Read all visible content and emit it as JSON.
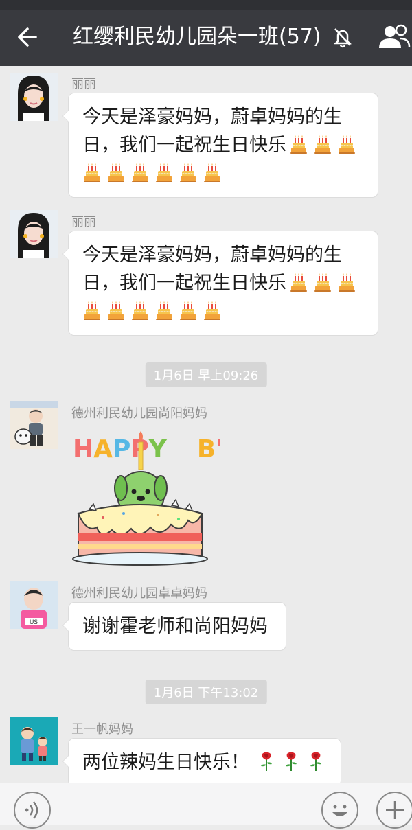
{
  "header": {
    "title": "红缨利民幼儿园朵一班(57)",
    "back_icon": "back-arrow-icon",
    "mute_icon": "bell-muted-icon",
    "members_icon": "group-members-icon"
  },
  "messages": [
    {
      "sender": "丽丽",
      "line1": "今天是泽豪妈妈，蔚卓妈妈的生",
      "line2": "日，我们一起祝生日快乐",
      "emoji": "cake",
      "emoji_count_line2": 3,
      "emoji_count_line3": 6
    },
    {
      "sender": "丽丽",
      "line1": "今天是泽豪妈妈，蔚卓妈妈的生",
      "line2": "日，我们一起祝生日快乐",
      "emoji": "cake",
      "emoji_count_line2": 3,
      "emoji_count_line3": 6
    },
    {
      "timestamp": "1月6日 早上09:26"
    },
    {
      "sender": "德州利民幼儿园尚阳妈妈",
      "sticker": {
        "text": "HAPPY B'DAY",
        "icon": "birthday-cake-sticker"
      }
    },
    {
      "sender": "德州利民幼儿园卓卓妈妈",
      "text": "谢谢霍老师和尚阳妈妈"
    },
    {
      "timestamp": "1月6日 下午13:02"
    },
    {
      "sender": "王一帆妈妈",
      "text": "两位辣妈生日快乐！",
      "emoji": "rose",
      "emoji_count": 3
    }
  ],
  "colors": {
    "header_bg": "#393a3f",
    "chat_bg": "#ebebeb",
    "bubble_bg": "#ffffff",
    "timestamp_bg": "#d6d6d6"
  },
  "bottom_bar": {
    "voice_icon": "voice-input-icon",
    "emoji_icon": "emoji-icon",
    "plus_icon": "plus-icon"
  }
}
